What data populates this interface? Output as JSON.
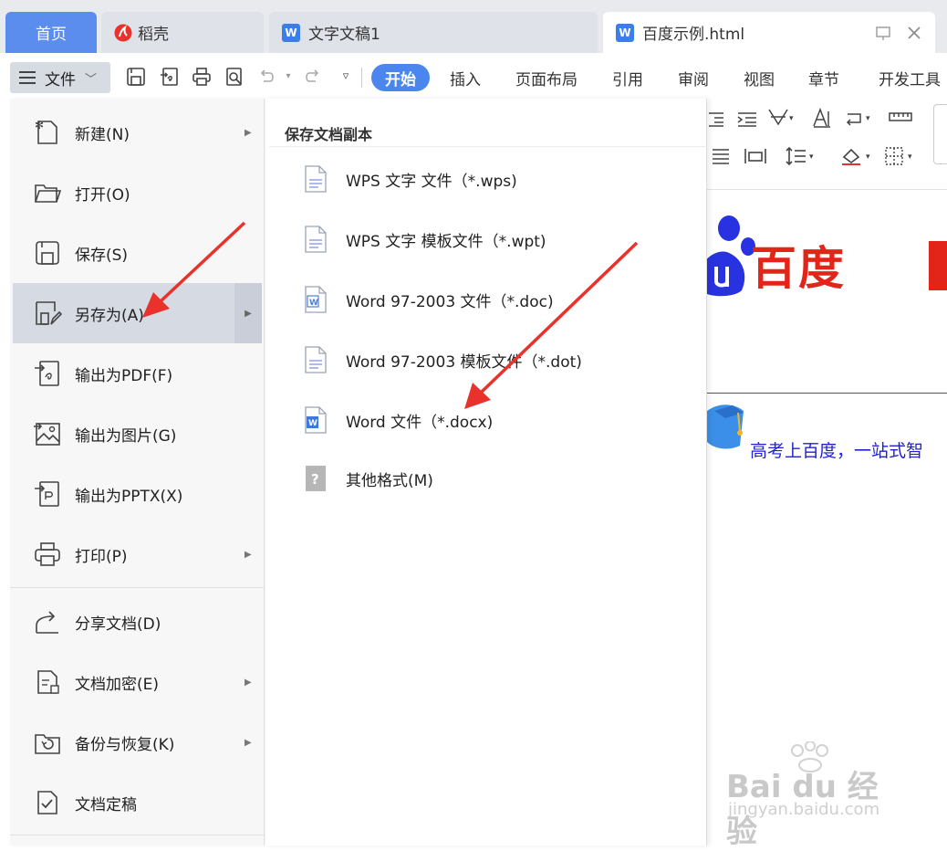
{
  "tabs": {
    "home": "首页",
    "daoke": "稻壳",
    "doc1": "文字文稿1",
    "active": "百度示例.html"
  },
  "toolbar": {
    "file_label": "文件",
    "ribbon_tabs": [
      "开始",
      "插入",
      "页面布局",
      "引用",
      "审阅",
      "视图",
      "章节",
      "开发工具"
    ]
  },
  "left_menu": {
    "items": [
      {
        "label": "新建(N)",
        "icon": "new-file-icon",
        "has_arrow": true
      },
      {
        "label": "打开(O)",
        "icon": "folder-icon",
        "has_arrow": false
      },
      {
        "label": "保存(S)",
        "icon": "save-icon",
        "has_arrow": false
      },
      {
        "label": "另存为(A)",
        "icon": "save-as-icon",
        "has_arrow": true
      },
      {
        "label": "输出为PDF(F)",
        "icon": "export-pdf-icon",
        "has_arrow": false
      },
      {
        "label": "输出为图片(G)",
        "icon": "export-image-icon",
        "has_arrow": false
      },
      {
        "label": "输出为PPTX(X)",
        "icon": "export-pptx-icon",
        "has_arrow": false
      },
      {
        "label": "打印(P)",
        "icon": "print-icon",
        "has_arrow": true
      },
      {
        "label": "分享文档(D)",
        "icon": "share-icon",
        "has_arrow": false
      },
      {
        "label": "文档加密(E)",
        "icon": "encrypt-icon",
        "has_arrow": true
      },
      {
        "label": "备份与恢复(K)",
        "icon": "backup-icon",
        "has_arrow": true
      },
      {
        "label": "文档定稿",
        "icon": "finalize-icon",
        "has_arrow": false
      }
    ]
  },
  "sub_menu": {
    "title": "保存文档副本",
    "items": [
      {
        "label": "WPS 文字 文件（*.wps)",
        "icon": "wps-file-icon"
      },
      {
        "label": "WPS 文字 模板文件（*.wpt)",
        "icon": "wps-template-icon"
      },
      {
        "label": "Word 97-2003 文件（*.doc)",
        "icon": "word-doc-icon"
      },
      {
        "label": "Word 97-2003 模板文件（*.dot)",
        "icon": "word-template-icon"
      },
      {
        "label": "Word 文件（*.docx)",
        "icon": "word-docx-icon"
      },
      {
        "label": "其他格式(M)",
        "icon": "other-format-icon"
      }
    ]
  },
  "document": {
    "logo_text": "百度",
    "link_text": "高考上百度，一站式智"
  },
  "watermark": {
    "main": "Bai du 经验",
    "sub": "jingyan.baidu.com"
  },
  "colors": {
    "accent": "#4a86ee",
    "home_tab": "#5b8def",
    "baidu_red": "#e32519",
    "baidu_blue": "#2932e1",
    "annotation_arrow": "#e8322b"
  }
}
